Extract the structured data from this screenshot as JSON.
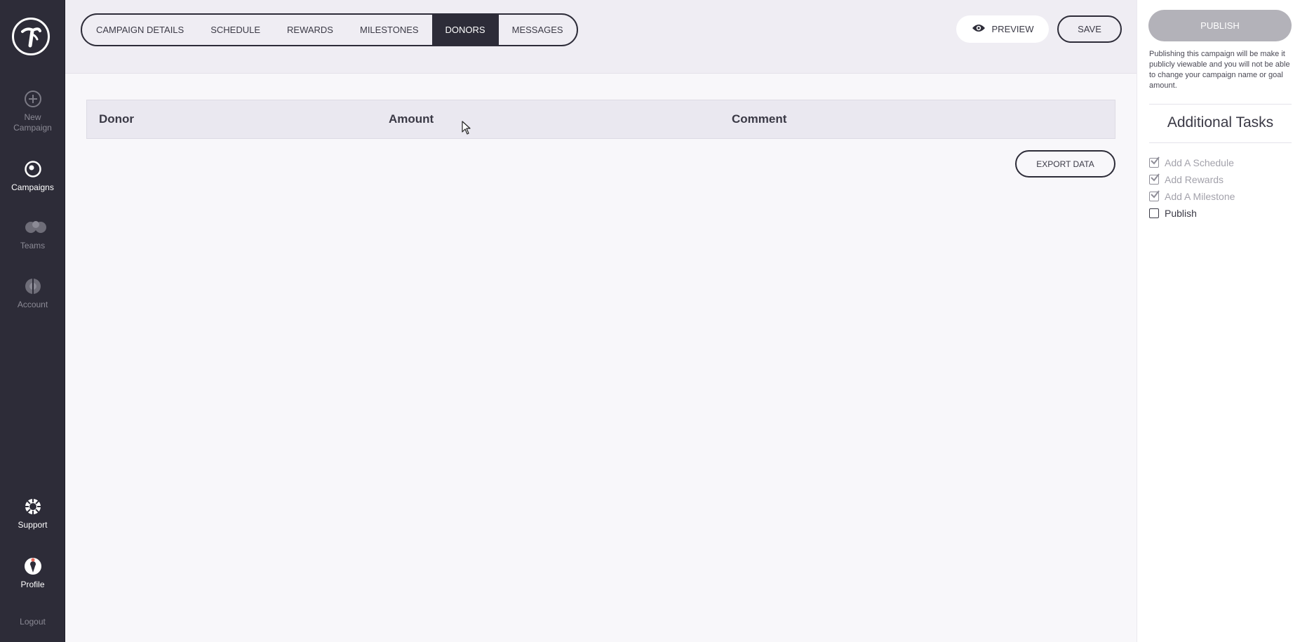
{
  "sidebar": {
    "logo": "thrivable-logo-icon",
    "items": [
      {
        "label": "New Campaign",
        "icon": "plus-circle-icon"
      },
      {
        "label": "Campaigns",
        "icon": "target-icon"
      },
      {
        "label": "Teams",
        "icon": "team-icon"
      },
      {
        "label": "Account",
        "icon": "account-icon"
      },
      {
        "label": "Support",
        "icon": "support-icon"
      },
      {
        "label": "Profile",
        "icon": "profile-icon"
      }
    ],
    "logout": "Logout"
  },
  "tabs": [
    {
      "label": "CAMPAIGN DETAILS",
      "active": false
    },
    {
      "label": "SCHEDULE",
      "active": false
    },
    {
      "label": "REWARDS",
      "active": false
    },
    {
      "label": "MILESTONES",
      "active": false
    },
    {
      "label": "DONORS",
      "active": true
    },
    {
      "label": "MESSAGES",
      "active": false
    }
  ],
  "header": {
    "preview_label": "PREVIEW",
    "save_label": "SAVE"
  },
  "donors_table": {
    "columns": [
      "Donor",
      "Amount",
      "Comment"
    ],
    "rows": []
  },
  "export_label": "EXPORT DATA",
  "right_panel": {
    "publish_label": "PUBLISH",
    "publish_note": "Publishing this campaign will be make it publicly viewable and you will not be able to change your campaign name or goal amount.",
    "tasks_title": "Additional Tasks",
    "tasks": [
      {
        "label": "Add A Schedule",
        "checked": true
      },
      {
        "label": "Add Rewards",
        "checked": true
      },
      {
        "label": "Add A Milestone",
        "checked": true
      },
      {
        "label": "Publish",
        "checked": false
      }
    ]
  },
  "colors": {
    "sidebar_bg": "#2d2c38",
    "accent_dark": "#2d2c38",
    "topbar_bg": "#efedf3",
    "page_bg": "#f8f7fa",
    "publish_disabled": "#b3b2b9"
  }
}
